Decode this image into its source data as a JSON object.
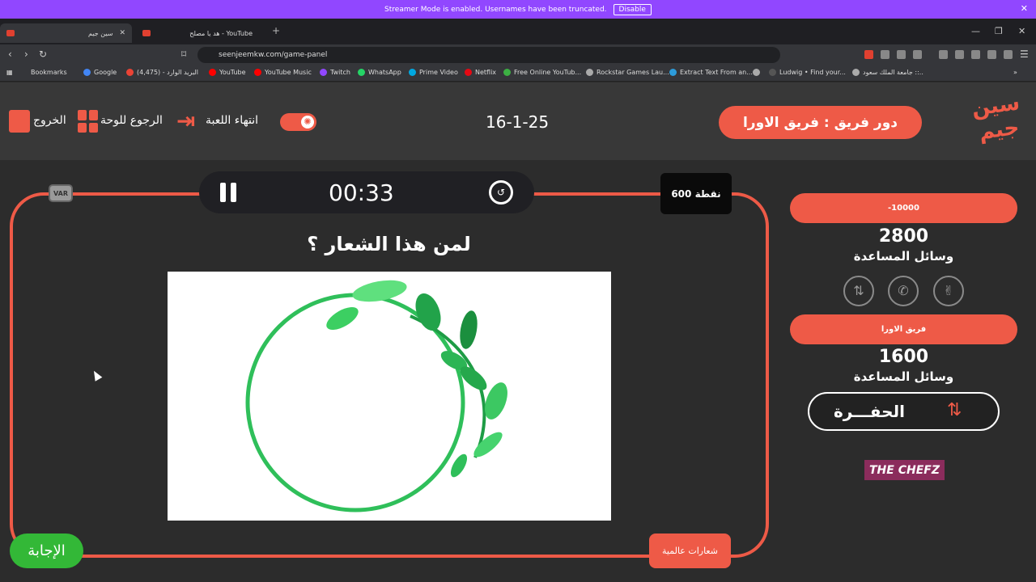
{
  "banner": {
    "message": "Streamer Mode is enabled. Usernames have been truncated.",
    "disable_label": "Disable"
  },
  "browser": {
    "tabs": [
      {
        "title": "سين جيم"
      },
      {
        "title": "هد يا مصلح - YouTube"
      }
    ],
    "url": "seenjeemkw.com/game-panel",
    "bookmarks": [
      "Bookmarks",
      "Google",
      "البريد الوارد - (4,475)",
      "YouTube",
      "YouTube Music",
      "Twitch",
      "WhatsApp",
      "Prime Video",
      "Netflix",
      "Free Online YouTub...",
      "Rockstar Games Lau...",
      "Extract Text From an...",
      "Ludwig • Find your...",
      "جامعة الملك سعود ::.."
    ]
  },
  "header": {
    "turn_label": "دور فريق : فريق الاورا",
    "logo_text": "سين جيم",
    "date": "16-1-25",
    "end_game_label": "انتهاء اللعبة",
    "back_to_board_label": "الرجوع للوحة",
    "exit_label": "الخروج"
  },
  "game": {
    "var_label": "VAR",
    "timer": "00:33",
    "points": "600 نقطة",
    "question": "لمن هذا الشعار ؟",
    "answer_label": "الإجابة",
    "category_label": "شعارات عالمية"
  },
  "teams": [
    {
      "name": "-10000",
      "score": "2800",
      "aids_label": "وسائل المساعدة"
    },
    {
      "name": "فريق الاورا",
      "score": "1600",
      "aids_label": "وسائل المساعدة"
    }
  ],
  "pit_label": "الحفـــرة",
  "sponsor": "THE CHEFZ",
  "colors": {
    "accent": "#ee5a47",
    "answer": "#33b837",
    "banner": "#9147ff"
  }
}
